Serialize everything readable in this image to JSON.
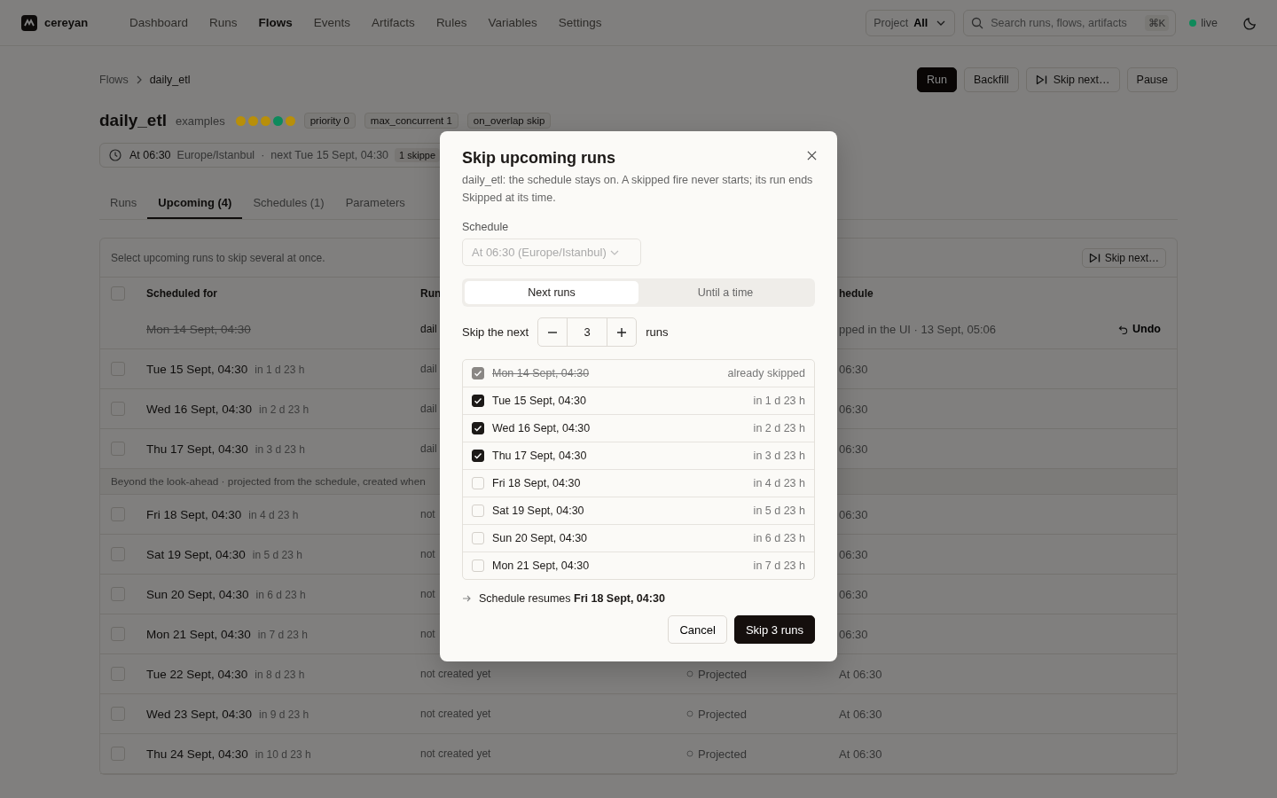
{
  "app": {
    "name": "cereyan"
  },
  "nav": [
    {
      "label": "Dashboard",
      "selected": false
    },
    {
      "label": "Runs",
      "selected": false
    },
    {
      "label": "Flows",
      "selected": true
    },
    {
      "label": "Events",
      "selected": false
    },
    {
      "label": "Artifacts",
      "selected": false
    },
    {
      "label": "Rules",
      "selected": false
    },
    {
      "label": "Variables",
      "selected": false
    },
    {
      "label": "Settings",
      "selected": false
    }
  ],
  "project": {
    "label": "Project",
    "value": "All"
  },
  "search": {
    "placeholder": "Search runs, flows, artifacts",
    "shortcut": "⌘K"
  },
  "status": {
    "label": "live",
    "color": "#0e8a5a"
  },
  "breadcrumbs": [
    "Flows",
    "daily_etl"
  ],
  "actions": [
    {
      "label": "Run",
      "kind": "primary"
    },
    {
      "label": "Backfill",
      "kind": "plain"
    },
    {
      "label": "Skip next…",
      "kind": "skip"
    },
    {
      "label": "Pause",
      "kind": "plain"
    }
  ],
  "flow": {
    "name": "daily_etl",
    "project": "examples",
    "recent": [
      {
        "color": "#b88f0a"
      },
      {
        "color": "#b88f0a"
      },
      {
        "color": "#b88f0a"
      },
      {
        "color": "#0d8a5c"
      },
      {
        "color": "#b88f0a"
      }
    ],
    "tags": [
      "priority 0",
      "max_concurrent 1",
      "on_overlap skip"
    ]
  },
  "schedule_bar": {
    "time": "At 06:30",
    "zone": "Europe/Istanbul",
    "separator": "·",
    "next": "next Tue 15 Sept, 04:30",
    "badge": "1 skippe"
  },
  "tabs": [
    {
      "label": "Runs",
      "selected": false
    },
    {
      "label": "Upcoming (4)",
      "selected": true
    },
    {
      "label": "Schedules (1)",
      "selected": false
    },
    {
      "label": "Parameters",
      "selected": false
    }
  ],
  "table": {
    "hint": "Select upcoming runs to skip several at once.",
    "skip_button": "Skip next…",
    "select_all": {
      "checked": false
    },
    "columns": [
      "Scheduled for",
      "Run",
      "hedule"
    ],
    "rows": [
      {
        "kind": "skipped",
        "date": "Mon 14 Sept, 04:30",
        "run": "dail",
        "note": "pped in the UI · 13 Sept, 05:06",
        "undo": "Undo"
      },
      {
        "kind": "run",
        "checked": false,
        "date": "Tue 15 Sept, 04:30",
        "relative": "in 1 d 23 h",
        "run": "dail",
        "schedule": "06:30"
      },
      {
        "kind": "run",
        "checked": false,
        "date": "Wed 16 Sept, 04:30",
        "relative": "in 2 d 23 h",
        "run": "dail",
        "schedule": "06:30"
      },
      {
        "kind": "run",
        "checked": false,
        "date": "Thu 17 Sept, 04:30",
        "relative": "in 3 d 23 h",
        "run": "dail",
        "schedule": "06:30"
      },
      {
        "kind": "group",
        "text": "Beyond the look-ahead · projected from the schedule, created when"
      },
      {
        "kind": "run",
        "checked": false,
        "date": "Fri 18 Sept, 04:30",
        "relative": "in 4 d 23 h",
        "run": "not",
        "schedule": "06:30"
      },
      {
        "kind": "run",
        "checked": false,
        "date": "Sat 19 Sept, 04:30",
        "relative": "in 5 d 23 h",
        "run": "not",
        "schedule": "06:30"
      },
      {
        "kind": "run",
        "checked": false,
        "date": "Sun 20 Sept, 04:30",
        "relative": "in 6 d 23 h",
        "run": "not",
        "schedule": "06:30"
      },
      {
        "kind": "run",
        "checked": false,
        "date": "Mon 21 Sept, 04:30",
        "relative": "in 7 d 23 h",
        "run": "not",
        "schedule": "06:30"
      },
      {
        "kind": "run",
        "checked": false,
        "date": "Tue 22 Sept, 04:30",
        "relative": "in 8 d 23 h",
        "run": "not created yet",
        "state": "Projected",
        "schedule": "At 06:30"
      },
      {
        "kind": "run",
        "checked": false,
        "date": "Wed 23 Sept, 04:30",
        "relative": "in 9 d 23 h",
        "run": "not created yet",
        "state": "Projected",
        "schedule": "At 06:30"
      },
      {
        "kind": "run",
        "checked": false,
        "date": "Thu 24 Sept, 04:30",
        "relative": "in 10 d 23 h",
        "run": "not created yet",
        "state": "Projected",
        "schedule": "At 06:30"
      }
    ]
  },
  "dialog": {
    "title": "Skip upcoming runs",
    "description": "daily_etl: the schedule stays on. A skipped fire never starts; its run ends Skipped at its time.",
    "schedule_label": "Schedule",
    "schedule_select": {
      "value": "At 06:30 (Europe/Istanbul)",
      "disabled": true
    },
    "modes": [
      {
        "label": "Next runs",
        "selected": true
      },
      {
        "label": "Until a time",
        "selected": false
      }
    ],
    "count_label": "Skip the next",
    "count": "3",
    "count_unit": "runs",
    "runs": [
      {
        "kind": "skipped",
        "checked": true,
        "date": "Mon 14 Sept, 04:30",
        "info": "already skipped"
      },
      {
        "kind": "run",
        "checked": true,
        "date": "Tue 15 Sept, 04:30",
        "info": "in 1 d 23 h"
      },
      {
        "kind": "run",
        "checked": true,
        "date": "Wed 16 Sept, 04:30",
        "info": "in 2 d 23 h"
      },
      {
        "kind": "run",
        "checked": true,
        "date": "Thu 17 Sept, 04:30",
        "info": "in 3 d 23 h"
      },
      {
        "kind": "run",
        "checked": false,
        "date": "Fri 18 Sept, 04:30",
        "info": "in 4 d 23 h"
      },
      {
        "kind": "run",
        "checked": false,
        "date": "Sat 19 Sept, 04:30",
        "info": "in 5 d 23 h"
      },
      {
        "kind": "run",
        "checked": false,
        "date": "Sun 20 Sept, 04:30",
        "info": "in 6 d 23 h"
      },
      {
        "kind": "run",
        "checked": false,
        "date": "Mon 21 Sept, 04:30",
        "info": "in 7 d 23 h"
      }
    ],
    "resume": "Schedule resumes **Fri 18 Sept, 04:30**",
    "cancel": "Cancel",
    "confirm": "Skip 3 runs"
  }
}
